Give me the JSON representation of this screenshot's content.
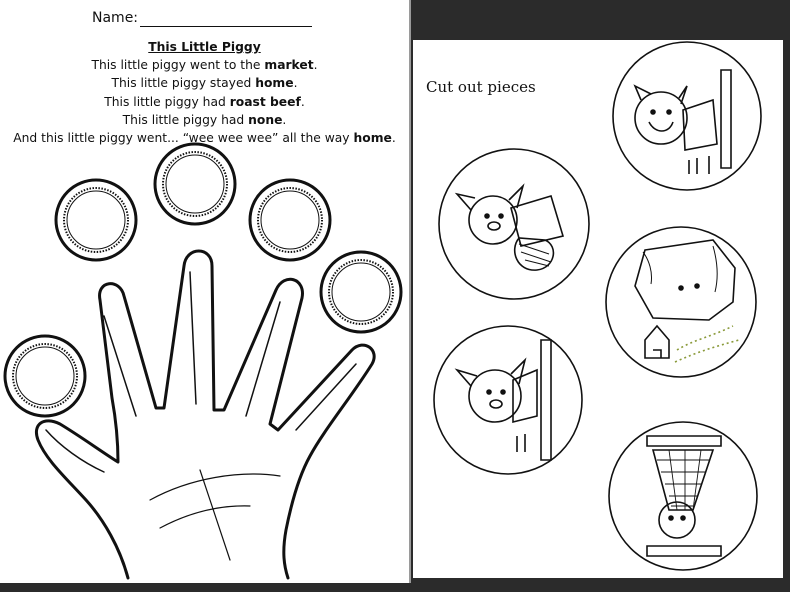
{
  "worksheet": {
    "name_label": "Name:",
    "title": "This Little Piggy",
    "lines": [
      {
        "pre": "This little piggy went to the ",
        "bold": "market",
        "post": "."
      },
      {
        "pre": "This little piggy stayed ",
        "bold": "home",
        "post": "."
      },
      {
        "pre": "This little piggy had ",
        "bold": "roast beef",
        "post": "."
      },
      {
        "pre": "This little piggy had ",
        "bold": "none",
        "post": "."
      },
      {
        "pre": "And this little piggy went... “wee wee wee” all the way ",
        "bold": "home",
        "post": "."
      }
    ]
  },
  "cutouts": {
    "label": "Cut out pieces",
    "pieces": [
      "piggy-roast-beef",
      "piggy-market",
      "piggy-wee-wee-home",
      "piggy-none",
      "piggy-stayed-home"
    ]
  }
}
